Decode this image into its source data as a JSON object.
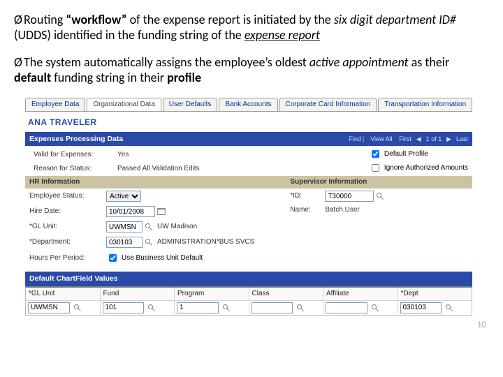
{
  "bullets": {
    "b1": {
      "prefix": "Routing ",
      "workflow": "“workflow”",
      "mid": " of the expense report is initiated by the ",
      "six_digit": "six digit department ID#",
      "udds": " (UDDS) identified in the funding string of the ",
      "expense_report": "expense report"
    },
    "b2": {
      "prefix": "The system automatically assigns the employee’s oldest ",
      "active_appt": "active appointment",
      "mid": " as their ",
      "default_w": "default",
      "mid2": " funding string in their ",
      "profile_w": "profile"
    }
  },
  "tabs": {
    "t1": "Employee Data",
    "t2": "Organizational Data",
    "t3": "User Defaults",
    "t4": "Bank Accounts",
    "t5": "Corporate Card Information",
    "t6": "Transportation Information"
  },
  "person": "ANA TRAVELER",
  "blue_band_title": "Expenses Processing Data",
  "nav": {
    "find": "Find",
    "view_all": "View All",
    "first": "First",
    "pager": "1 of 1",
    "last": "Last"
  },
  "valid_label": "Valid for Expenses:",
  "valid_value": "Yes",
  "chk_default": "Default Profile",
  "chk_ignore": "Ignore Authorized Amounts",
  "reason_label": "Reason for Status:",
  "reason_value": "Passed All Validation Edits",
  "hr_title": "HR Information",
  "sup_title": "Supervisor Information",
  "hr": {
    "emp_status_label": "Employee Status:",
    "emp_status_value": "Active",
    "hire_label": "Hire Date:",
    "hire_value": "10/01/2008",
    "gl_label": "*GL Unit:",
    "gl_value": "UWMSN",
    "gl_desc": "UW Madison",
    "dept_label": "*Department:",
    "dept_value": "030103",
    "dept_desc": "ADMINISTRATION*BUS SVCS",
    "hours_label": "Hours Per Period:",
    "hours_chk": "Use Business Unit Default"
  },
  "sup": {
    "id_label": "*ID:",
    "id_value": "T30000",
    "name_label": "Name:",
    "name_value": "Batch,User"
  },
  "cf_title": "Default ChartField Values",
  "cf": {
    "h0": "*GL Unit",
    "h1": "Fund",
    "h2": "Program",
    "h3": "Class",
    "h4": "Affiliate",
    "h5": "*Dept",
    "v0": "UWMSN",
    "v1": "101",
    "v2": "1",
    "v3": "",
    "v4": "",
    "v5": "030103"
  },
  "page_num": "10"
}
